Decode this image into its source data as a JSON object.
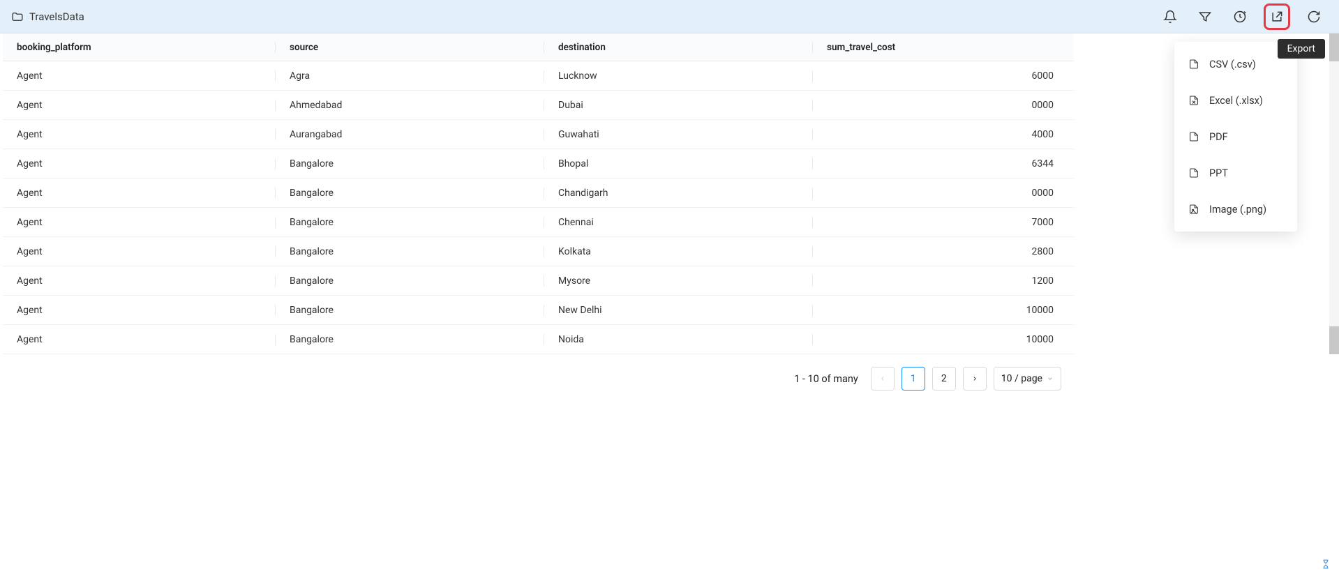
{
  "header": {
    "title": "TravelsData"
  },
  "tooltip": "Export",
  "export_menu": [
    {
      "label": "CSV (.csv)"
    },
    {
      "label": "Excel (.xlsx)"
    },
    {
      "label": "PDF"
    },
    {
      "label": "PPT"
    },
    {
      "label": "Image (.png)"
    }
  ],
  "table": {
    "columns": [
      "booking_platform",
      "source",
      "destination",
      "sum_travel_cost"
    ],
    "rows": [
      {
        "booking_platform": "Agent",
        "source": "Agra",
        "destination": "Lucknow",
        "sum_travel_cost": "6000"
      },
      {
        "booking_platform": "Agent",
        "source": "Ahmedabad",
        "destination": "Dubai",
        "sum_travel_cost": "0000"
      },
      {
        "booking_platform": "Agent",
        "source": "Aurangabad",
        "destination": "Guwahati",
        "sum_travel_cost": "4000"
      },
      {
        "booking_platform": "Agent",
        "source": "Bangalore",
        "destination": "Bhopal",
        "sum_travel_cost": "6344"
      },
      {
        "booking_platform": "Agent",
        "source": "Bangalore",
        "destination": "Chandigarh",
        "sum_travel_cost": "0000"
      },
      {
        "booking_platform": "Agent",
        "source": "Bangalore",
        "destination": "Chennai",
        "sum_travel_cost": "7000"
      },
      {
        "booking_platform": "Agent",
        "source": "Bangalore",
        "destination": "Kolkata",
        "sum_travel_cost": "2800"
      },
      {
        "booking_platform": "Agent",
        "source": "Bangalore",
        "destination": "Mysore",
        "sum_travel_cost": "1200"
      },
      {
        "booking_platform": "Agent",
        "source": "Bangalore",
        "destination": "New Delhi",
        "sum_travel_cost": "10000"
      },
      {
        "booking_platform": "Agent",
        "source": "Bangalore",
        "destination": "Noida",
        "sum_travel_cost": "10000"
      }
    ]
  },
  "pagination": {
    "info": "1 - 10 of many",
    "prev": "<",
    "page1": "1",
    "page2": "2",
    "next": ">",
    "page_size": "10 / page"
  }
}
